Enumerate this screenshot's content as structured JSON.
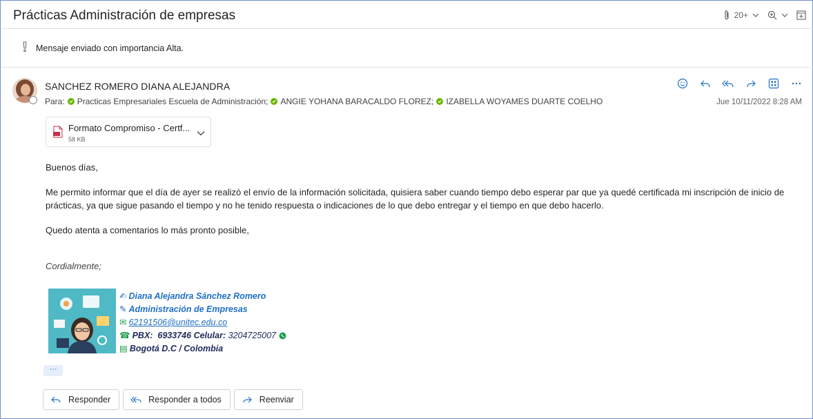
{
  "subject": "Prácticas Administración de empresas",
  "header_tools": {
    "attachment_count": "20+"
  },
  "importance": "Mensaje enviado con importancia Alta.",
  "sender": "SANCHEZ ROMERO DIANA ALEJANDRA",
  "to_label": "Para:",
  "recipients": [
    "Practicas Empresariales Escuela de Administración;",
    "ANGIE YOHANA BARACALDO FLOREZ;",
    "IZABELLA WOYAMES DUARTE COELHO"
  ],
  "date": "Jue 10/11/2022 8:28 AM",
  "attachment": {
    "name": "Formato Compromiso - Certf...",
    "size": "58 KB"
  },
  "body": {
    "greeting": "Buenos días,",
    "paragraph": "Me permito informar que el día de ayer se realizó el envío de la información solicitada, quisiera saber cuando tiempo debo esperar par que ya quedé certificada mi inscripción de inicio de prácticas, ya que sigue pasando el tiempo y no he tenido respuesta o indicaciones de lo que debo entregar y el tiempo en que debo hacerlo.",
    "closing": "Quedo atenta a comentarios lo más pronto posible,",
    "signoff": "Cordialmente;"
  },
  "signature": {
    "name": "Diana Alejandra Sánchez Romero",
    "program": "Administración de Empresas",
    "email": "62191506@unitec.edu.co",
    "pbx_label": "PBX:",
    "pbx": "6933746",
    "cel_label": "Celular:",
    "cel": "3204725007",
    "city": "Bogotá D.C / Colombia"
  },
  "more": "···",
  "buttons": {
    "reply": "Responder",
    "reply_all": "Responder a todos",
    "forward": "Reenviar"
  },
  "colors": {
    "accent": "#1f6fc5",
    "presence_green": "#6bb700",
    "border": "#6f8fcf"
  }
}
